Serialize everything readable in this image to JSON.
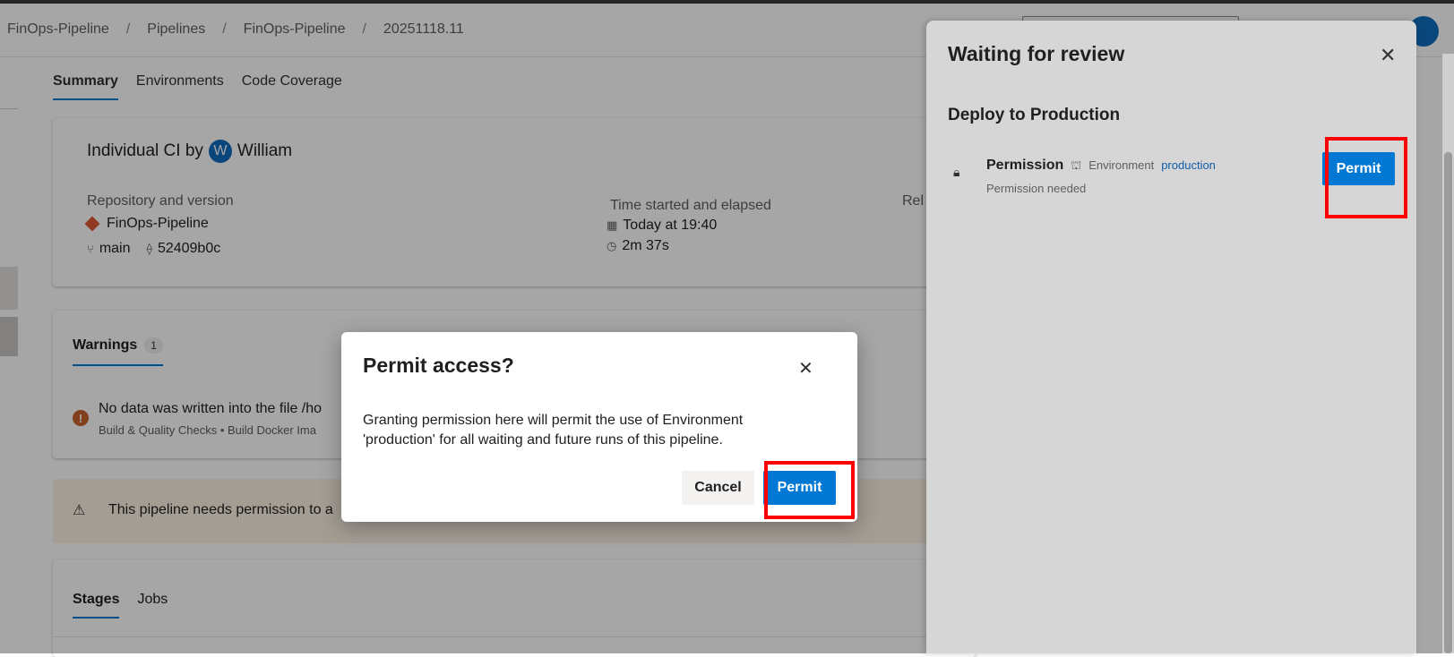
{
  "breadcrumb": [
    "FinOps-Pipeline",
    "Pipelines",
    "FinOps-Pipeline",
    "20251118.11"
  ],
  "breadcrumb_separator": "/",
  "tabs": [
    "Summary",
    "Environments",
    "Code Coverage"
  ],
  "summary": {
    "title_prefix": "Individual CI by",
    "avatar_initial": "W",
    "user": "William",
    "repo_label": "Repository and version",
    "repo_name": "FinOps-Pipeline",
    "branch": "main",
    "commit": "52409b0c",
    "time_label": "Time started and elapsed",
    "time_started": "Today at 19:40",
    "elapsed": "2m 37s",
    "truncated_label": "Rel"
  },
  "warnings": {
    "tab_label": "Warnings",
    "count": "1",
    "message": "No data was written into the file /ho",
    "sub": "Build & Quality Checks • Build Docker Ima"
  },
  "banner": {
    "text": "This pipeline needs permission to a"
  },
  "stages_tabs": [
    "Stages",
    "Jobs"
  ],
  "panel": {
    "title": "Waiting for review",
    "subtitle": "Deploy to Production",
    "permission_title": "Permission",
    "environment_label": "Environment",
    "environment_link": "production",
    "permission_status": "Permission needed",
    "permit_label": "Permit"
  },
  "modal": {
    "title": "Permit access?",
    "body": "Granting permission here will permit the use of Environment 'production' for all waiting and future runs of this pipeline.",
    "cancel_label": "Cancel",
    "permit_label": "Permit"
  },
  "colors": {
    "accent": "#0078d4",
    "highlight": "#ff0000",
    "warning": "#c8612a",
    "overlay": "rgba(0,0,0,0.35)"
  },
  "icons": [
    "git-repo-icon",
    "branch-icon",
    "commit-icon",
    "calendar-icon",
    "clock-icon",
    "warning-circle-icon",
    "warning-triangle-icon",
    "lock-icon",
    "environment-icon",
    "close-icon"
  ]
}
